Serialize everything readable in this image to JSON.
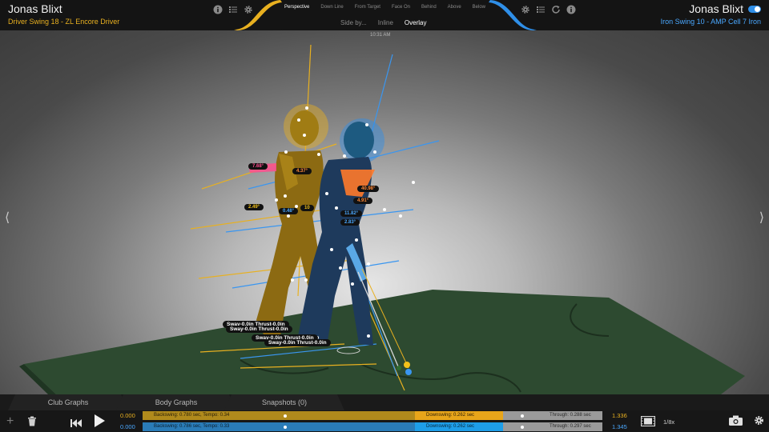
{
  "header": {
    "left": {
      "player": "Jonas Blixt",
      "swing": "Driver Swing 18 - ZL Encore Driver"
    },
    "right": {
      "player": "Jonas Blixt",
      "swing": "Iron Swing 10 - AMP Cell 7 Iron"
    },
    "views": [
      "Perspective",
      "Down Line",
      "From Target",
      "Face On",
      "Behind",
      "Above",
      "Below"
    ],
    "active_view": "Perspective",
    "modes": [
      "Side by...",
      "Inline",
      "Overlay"
    ],
    "active_mode": "Overlay",
    "timestamp": "10:31 AM"
  },
  "scene": {
    "angle_labels": {
      "pink": "7.68°",
      "yellow_hip": "4.37°",
      "orange_big": "40.98°",
      "orange_small": "4.91°",
      "yellow_knee": "2.49°",
      "blue_knee": "0.48°",
      "yellow_short": "10",
      "blue_a": "11.82°",
      "blue_b": "2.83°"
    },
    "sway_labels": [
      "Sway-0.0in Thrust-0.0in",
      "Sway-0.0in Thrust-0.0in",
      "Sway-0.0in Thrust-0.0in",
      "Sway-0.0in Thrust-0.0in"
    ],
    "colors": {
      "gold": "#e8b020",
      "blue": "#2f8fe8",
      "pink": "#ff4e8e",
      "orange": "#ff7a2a",
      "mat": "#2d4a30"
    }
  },
  "bottom_tabs": [
    "Club Graphs",
    "Body Graphs",
    "Snapshots (0)"
  ],
  "timeline": {
    "gold": {
      "start": "0.000",
      "end": "1.336",
      "backswing": "Backswing: 0.780 sec, Tempo: 0.34",
      "downswing": "Downswing: 0.262 sec",
      "through": "Through: 0.288 sec"
    },
    "blue": {
      "start": "0.000",
      "end": "1.345",
      "backswing": "Backswing: 0.786 sec, Tempo: 0.33",
      "downswing": "Downswing: 0.262 sec",
      "through": "Through: 0.297 sec"
    },
    "playback_speed": "1/8x"
  },
  "icons": [
    "info-icon",
    "list-icon",
    "gear-icon",
    "refresh-icon",
    "add-icon",
    "trash-icon",
    "rewind-icon",
    "play-icon",
    "film-icon",
    "camera-icon"
  ]
}
